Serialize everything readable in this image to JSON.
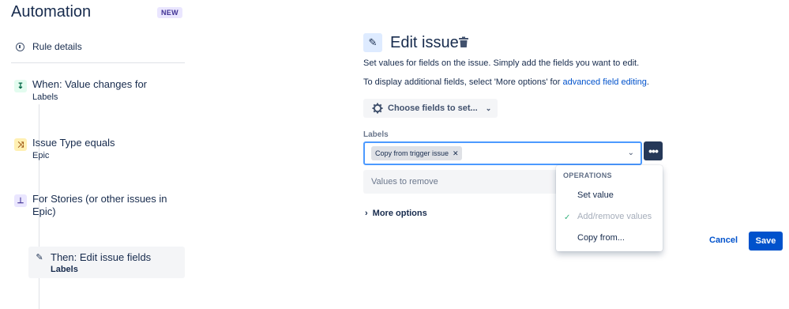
{
  "app": {
    "title": "Automation",
    "badge": "NEW"
  },
  "sidebar": {
    "rule_details": "Rule details",
    "steps": [
      {
        "title": "When: Value changes for",
        "subtitle": "Labels",
        "icon": "trigger-icon"
      },
      {
        "title": "Issue Type equals",
        "subtitle": "Epic",
        "icon": "condition-icon"
      },
      {
        "title_line1": "For Stories (or other issues in",
        "title_line2": "Epic)",
        "icon": "branch-icon"
      }
    ],
    "selected": {
      "title": "Then: Edit issue fields",
      "subtitle": "Labels",
      "icon": "pencil-icon"
    }
  },
  "panel": {
    "title": "Edit issue",
    "desc1": "Set values for fields on the issue. Simply add the fields you want to edit.",
    "desc2_prefix": "To display additional fields, select 'More options' for ",
    "desc2_link": "advanced field editing",
    "desc2_suffix": ".",
    "choose_fields": "Choose fields to set...",
    "labels_label": "Labels",
    "labels_chip": "Copy from trigger issue",
    "values_to_remove": "Values to remove",
    "more_options": "More options",
    "cancel": "Cancel",
    "save": "Save"
  },
  "dropdown": {
    "heading": "OPERATIONS",
    "items": [
      "Set value",
      "Add/remove values",
      "Copy from..."
    ],
    "selected_index": 1
  },
  "colors": {
    "accent": "#0052cc",
    "focus": "#4c9aff",
    "dark_button": "#253858"
  }
}
